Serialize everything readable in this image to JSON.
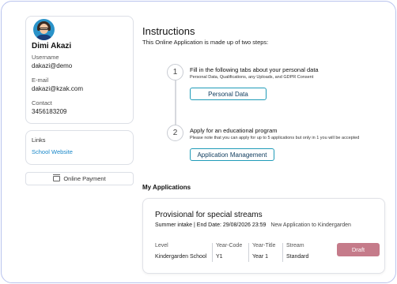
{
  "profile": {
    "name": "Dimi Akazi",
    "username_label": "Username",
    "username": "dakazi@demo",
    "email_label": "E-mail",
    "email": "dakazi@kzak.com",
    "contact_label": "Contact",
    "contact": "3456183209"
  },
  "links": {
    "title": "Links",
    "items": [
      "School Website"
    ]
  },
  "payment_label": "Online Payment",
  "instructions": {
    "heading": "Instructions",
    "subtext": "This Online Application is made up of two steps:",
    "steps": [
      {
        "number": "1",
        "title": "Fill in the following tabs about your personal data",
        "note": "Personal Data, Qualifications, any Uploads, and GDPR Consent",
        "button": "Personal Data"
      },
      {
        "number": "2",
        "title": "Apply for an educational program",
        "note": "Please note that you can apply for up to 5 applications but only in 1 you will be accepted",
        "button": "Application Management"
      }
    ]
  },
  "my_applications": {
    "title": "My Applications",
    "card": {
      "title": "Provisional for special streams",
      "intake": "Summer intake | End Date: 29/08/2026 23:59",
      "description": "New Application to Kindergarden",
      "columns": [
        {
          "label": "Level",
          "value": "Kindergarden School"
        },
        {
          "label": "Year-Code",
          "value": "Y1"
        },
        {
          "label": "Year-Title",
          "value": "Year 1"
        },
        {
          "label": "Stream",
          "value": "Standard"
        }
      ],
      "status": "Draft"
    }
  },
  "colors": {
    "accent_link": "#1a88c9",
    "button_border": "#1f9bb8",
    "draft_badge": "#c57b8a",
    "frame_border": "#b9c3ee"
  }
}
